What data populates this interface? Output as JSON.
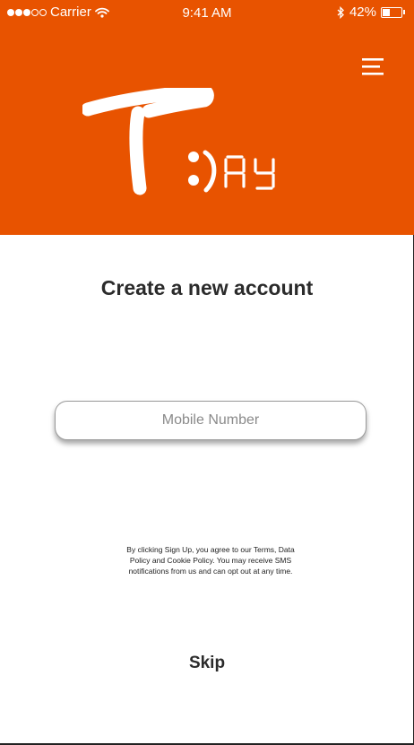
{
  "status_bar": {
    "signal_filled": 3,
    "signal_total": 5,
    "carrier": "Carrier",
    "time": "9:41 AM",
    "battery_percent": "42%",
    "battery_level": 0.42,
    "icons": [
      "wifi-icon",
      "bluetooth-icon",
      "battery-icon"
    ]
  },
  "header": {
    "background_color": "#e85300",
    "menu_icon": "hamburger-menu-icon",
    "logo_alt": "T:) Ay"
  },
  "main": {
    "title": "Create a new account",
    "mobile_field": {
      "placeholder": "Mobile Number",
      "value": ""
    },
    "terms_text": "By clicking Sign Up, you agree to our Terms, Data Policy and Cookie Policy. You may receive SMS notifications from us and can opt out at any time.",
    "skip_label": "Skip"
  }
}
